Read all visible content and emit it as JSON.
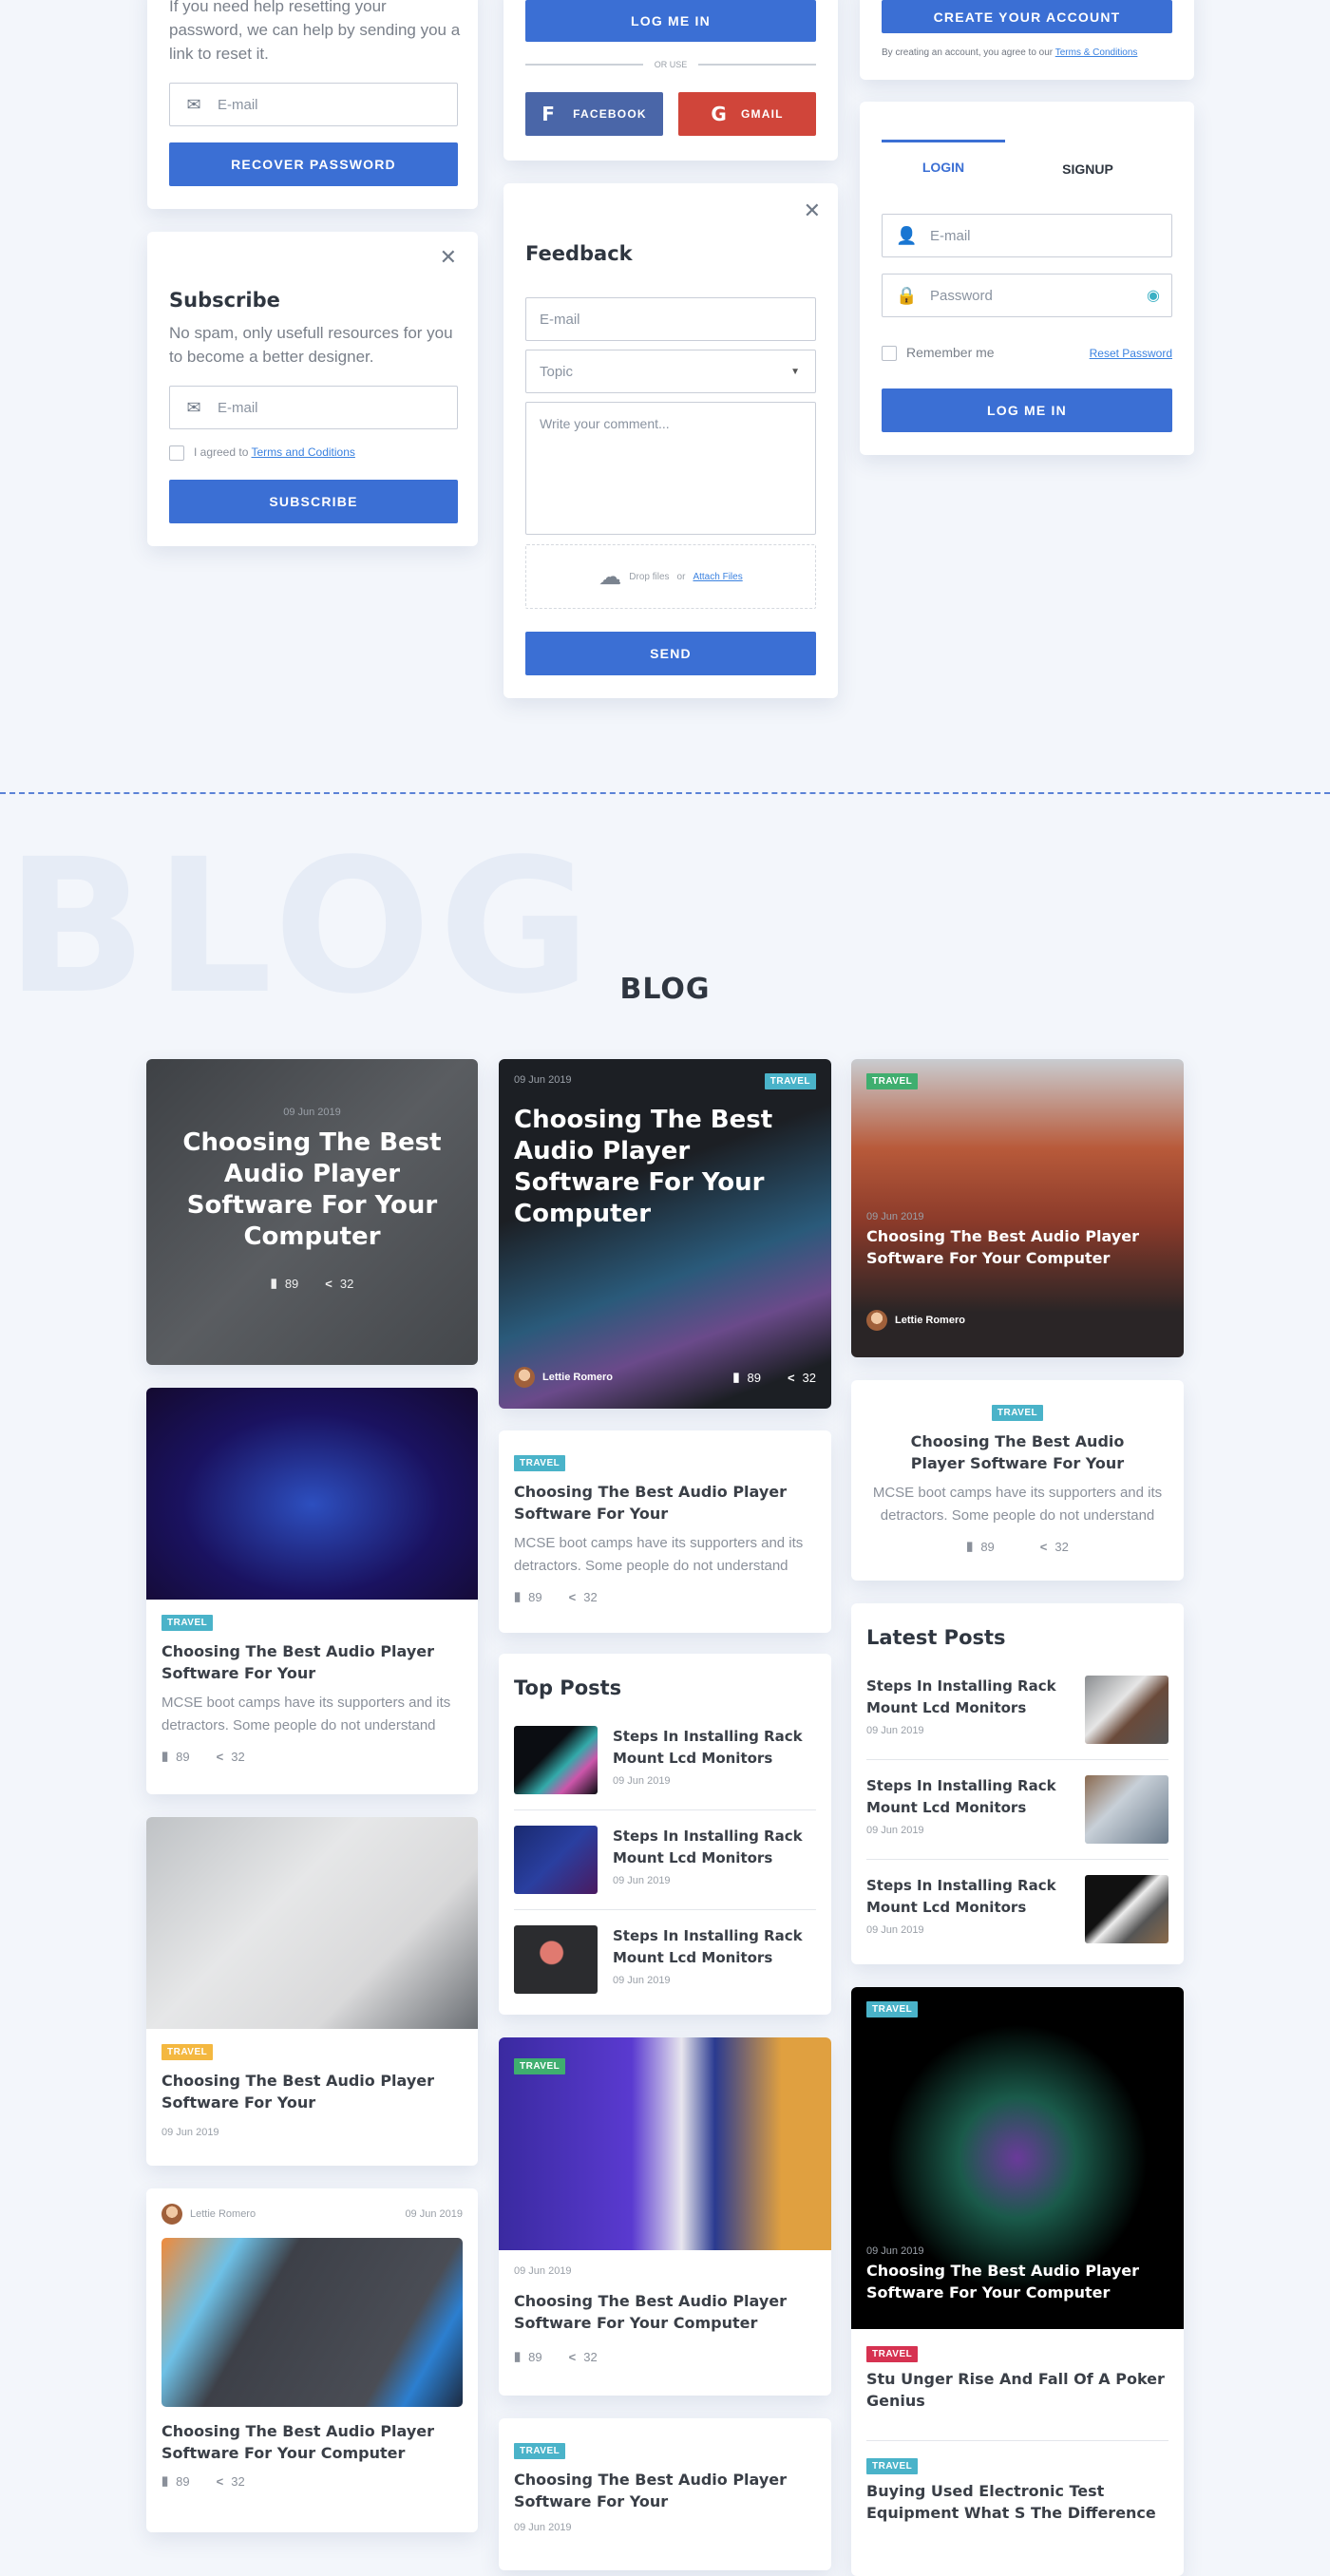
{
  "colors": {
    "primary": "#3b6fd4",
    "facebook": "#4a66a8",
    "gmail": "#d0453a",
    "travel": "#4ab3c9",
    "background": "#f3f6fb"
  },
  "recover": {
    "text": "If you need help resetting your password, we can help by sending you a link to reset it.",
    "email_placeholder": "E-mail",
    "button": "Recover Password",
    "icon": "envelope-icon"
  },
  "subscribe": {
    "title": "Subscribe",
    "text": "No spam, only usefull resources for you to become a better designer.",
    "email_placeholder": "E-mail",
    "agree": "I agreed to",
    "terms": "Terms and Coditions",
    "button": "Subscribe"
  },
  "social_login": {
    "button": "Log me in",
    "or_use": "OR USE",
    "facebook": "Facebook",
    "gmail": "Gmail"
  },
  "feedback": {
    "title": "Feedback",
    "email_placeholder": "E-mail",
    "topic": "Topic",
    "comment_placeholder": "Write your comment...",
    "drop": "Drop files",
    "or": "or",
    "attach": "Attach Files",
    "button": "Send"
  },
  "create": {
    "button": "Create your account",
    "agree": "By creating an account, you agree to our",
    "terms": "Terms & Conditions"
  },
  "login": {
    "tabs": [
      "Login",
      "Signup"
    ],
    "active_tab": "Login",
    "email_placeholder": "E-mail",
    "password_placeholder": "Password",
    "remember": "Remember me",
    "reset": "Reset Password",
    "button": "Log me in"
  },
  "blog": {
    "watermark": "BLOG",
    "title": "BLOG",
    "badge": "TRAVEL",
    "date": "09 Jun 2019",
    "author": "Lettie Romero",
    "comments": "89",
    "shares": "32",
    "title_long": "Choosing The Best Audio Player Software For Your Computer",
    "title_short": "Choosing The Best Audio Player Software For Your",
    "excerpt": "MCSE boot camps have its supporters and its detractors. Some people do not understand",
    "top_posts": {
      "title": "Top Posts",
      "items": [
        {
          "title": "Steps In Installing Rack Mount Lcd Monitors",
          "date": "09 Jun 2019"
        },
        {
          "title": "Steps In Installing Rack Mount Lcd Monitors",
          "date": "09 Jun 2019"
        },
        {
          "title": "Steps In Installing Rack Mount Lcd Monitors",
          "date": "09 Jun 2019"
        }
      ]
    },
    "latest_posts": {
      "title": "Latest Posts",
      "items": [
        {
          "title": "Steps In Installing Rack Mount Lcd Monitors",
          "date": "09 Jun 2019"
        },
        {
          "title": "Steps In Installing Rack Mount Lcd Monitors",
          "date": "09 Jun 2019"
        },
        {
          "title": "Steps In Installing Rack Mount Lcd Monitors",
          "date": "09 Jun 2019"
        }
      ]
    },
    "list": [
      {
        "badge": "TRAVEL",
        "title": "Stu Unger Rise And Fall Of A Poker Genius"
      },
      {
        "badge": "TRAVEL",
        "title": "Buying Used Electronic Test Equipment What S The Difference"
      }
    ]
  }
}
